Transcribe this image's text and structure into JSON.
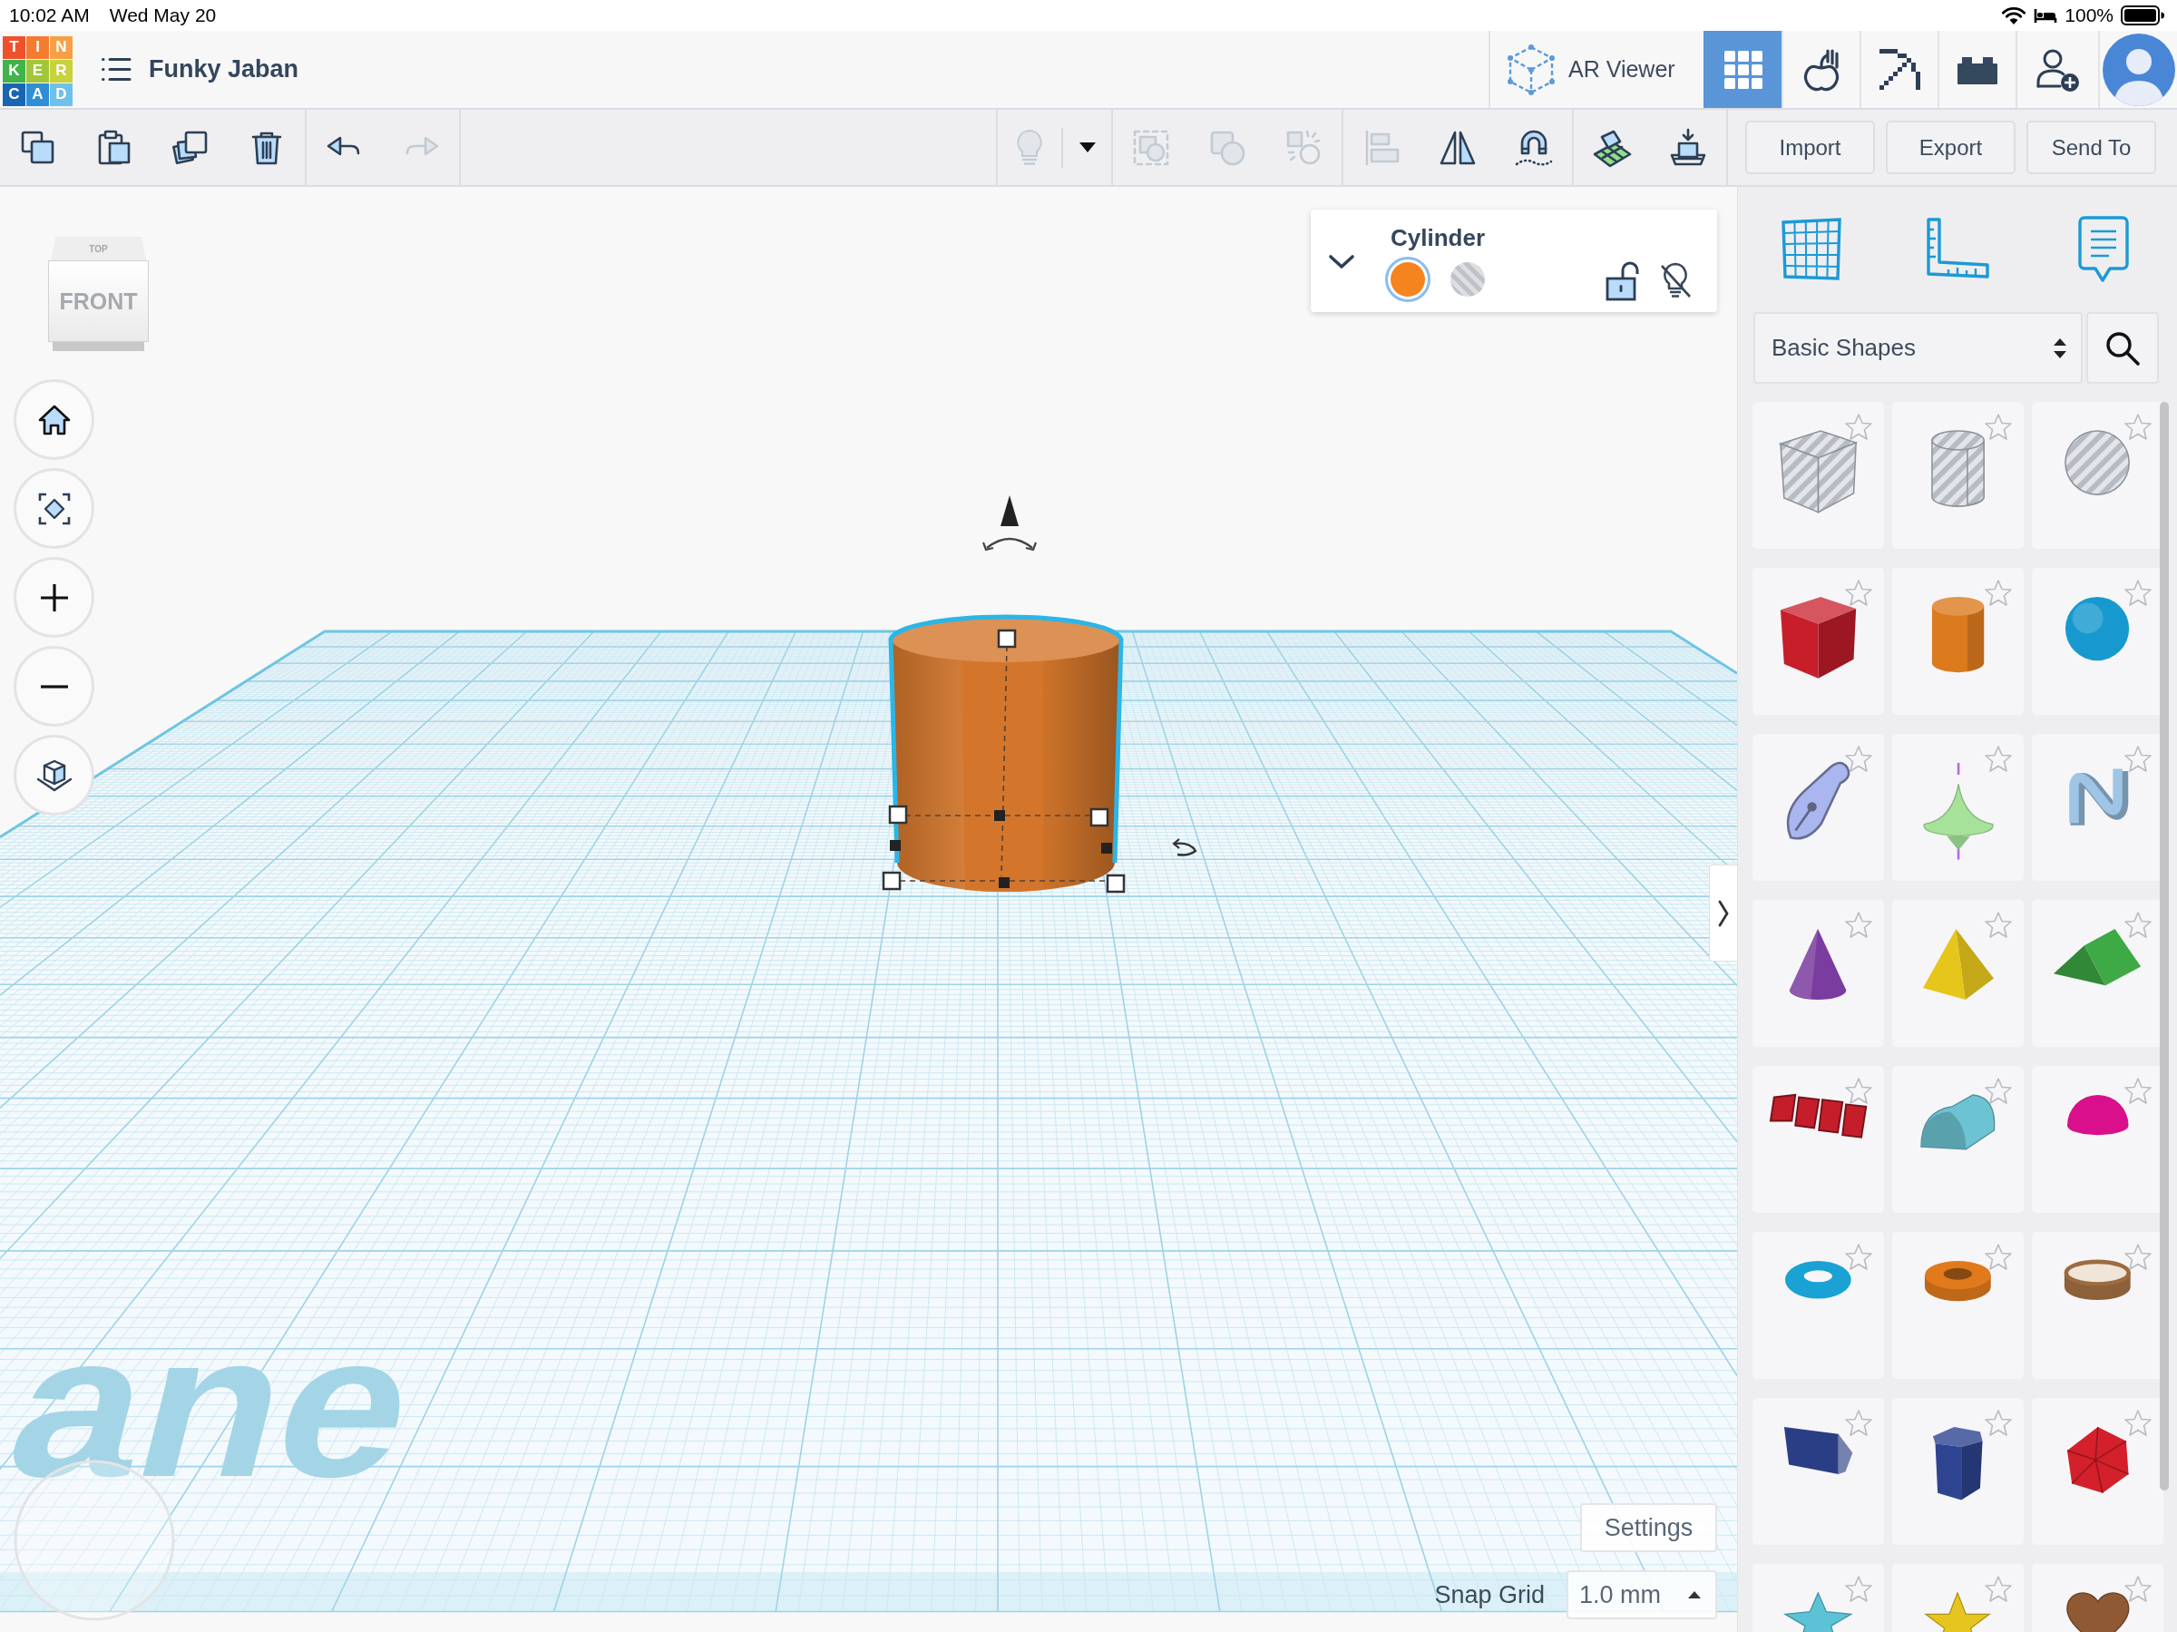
{
  "status_bar": {
    "time": "10:02 AM",
    "date": "Wed May 20",
    "battery": "100%"
  },
  "header": {
    "logo": [
      {
        "letter": "T",
        "color": "#ef512d"
      },
      {
        "letter": "I",
        "color": "#f47b30"
      },
      {
        "letter": "N",
        "color": "#f6a046"
      },
      {
        "letter": "K",
        "color": "#41b34a"
      },
      {
        "letter": "E",
        "color": "#a2c63a"
      },
      {
        "letter": "R",
        "color": "#c8d33b"
      },
      {
        "letter": "C",
        "color": "#1866b1"
      },
      {
        "letter": "A",
        "color": "#2f8fd6"
      },
      {
        "letter": "D",
        "color": "#6ec1e8"
      }
    ],
    "title": "Funky Jaban",
    "ar_viewer": "AR Viewer",
    "modes": [
      {
        "kind": "grid",
        "selected": true
      },
      {
        "kind": "apple",
        "selected": false
      },
      {
        "kind": "pickaxe",
        "selected": false
      },
      {
        "kind": "brick",
        "selected": false
      }
    ]
  },
  "toolbar": {
    "left_groups": [
      [
        {
          "kind": "copy",
          "disabled": false
        },
        {
          "kind": "paste",
          "disabled": false
        },
        {
          "kind": "duplicate",
          "disabled": false
        },
        {
          "kind": "delete",
          "disabled": false
        }
      ],
      [
        {
          "kind": "undo",
          "disabled": false
        },
        {
          "kind": "redo",
          "disabled": true
        }
      ]
    ],
    "right_groups": [
      [
        {
          "kind": "bulb",
          "disabled": true
        },
        {
          "kind": "caret",
          "disabled": false
        }
      ],
      [
        {
          "kind": "group",
          "disabled": true
        },
        {
          "kind": "combine",
          "disabled": true
        },
        {
          "kind": "ungroup",
          "disabled": true
        }
      ],
      [
        {
          "kind": "align",
          "disabled": true
        },
        {
          "kind": "mirror",
          "disabled": false
        },
        {
          "kind": "magnet",
          "disabled": false
        }
      ],
      [
        {
          "kind": "workplane",
          "disabled": false
        },
        {
          "kind": "drop",
          "disabled": false
        }
      ]
    ],
    "buttons": [
      "Import",
      "Export",
      "Send To"
    ]
  },
  "canvas": {
    "view_cube": {
      "top": "TOP",
      "front": "FRONT"
    },
    "nav_buttons": [
      {
        "kind": "home"
      },
      {
        "kind": "fit"
      },
      {
        "kind": "zoom-in"
      },
      {
        "kind": "zoom-out"
      },
      {
        "kind": "ortho"
      }
    ],
    "inspector": {
      "expanded": false,
      "title": "Cylinder",
      "options": [
        {
          "kind": "solid",
          "color": "#f5841f",
          "selected": true
        },
        {
          "kind": "hole",
          "selected": false
        }
      ],
      "locked": false
    },
    "object": {
      "kind": "cylinder",
      "color": "#d3762b",
      "selected": true
    },
    "workplane_label": "ane",
    "settings": "Settings",
    "snap_grid": {
      "label": "Snap Grid",
      "value": "1.0 mm"
    }
  },
  "library": {
    "tools": [
      {
        "kind": "workplane"
      },
      {
        "kind": "ruler"
      },
      {
        "kind": "notes"
      }
    ],
    "category": "Basic Shapes",
    "shapes": [
      {
        "kind": "box",
        "hole": true,
        "favorite": false
      },
      {
        "kind": "cylinder",
        "hole": true,
        "favorite": false
      },
      {
        "kind": "sphere",
        "hole": true,
        "favorite": false
      },
      {
        "kind": "box",
        "hole": false,
        "color": "#c81e2a",
        "favorite": false
      },
      {
        "kind": "cylinder",
        "hole": false,
        "color": "#dc7a1e",
        "favorite": false
      },
      {
        "kind": "sphere",
        "hole": false,
        "color": "#1799cf",
        "favorite": false
      },
      {
        "kind": "scribble",
        "hole": false,
        "color": "#aab6ef",
        "favorite": false
      },
      {
        "kind": "paraboloid",
        "hole": false,
        "color": "#a6e29a",
        "favorite": false
      },
      {
        "kind": "curve",
        "hole": false,
        "color": "#9ec5e6",
        "favorite": false
      },
      {
        "kind": "cone",
        "hole": false,
        "color": "#7a3c9e",
        "favorite": false
      },
      {
        "kind": "pyramid",
        "hole": false,
        "color": "#e6c61b",
        "favorite": false
      },
      {
        "kind": "roof",
        "hole": false,
        "color": "#3daa45",
        "favorite": false
      },
      {
        "kind": "text",
        "hole": false,
        "color": "#c41e2b",
        "favorite": false
      },
      {
        "kind": "round-roof",
        "hole": false,
        "color": "#6cc4d2",
        "favorite": false
      },
      {
        "kind": "half-sphere",
        "hole": false,
        "color": "#d90f8c",
        "favorite": false
      },
      {
        "kind": "torus",
        "hole": false,
        "color": "#1aa2d4",
        "favorite": false
      },
      {
        "kind": "tube",
        "hole": false,
        "color": "#e07a1c",
        "favorite": false
      },
      {
        "kind": "ring",
        "hole": false,
        "color": "#9c6b3f",
        "favorite": false
      },
      {
        "kind": "pentagonal-prism",
        "hole": false,
        "color": "#2a3e85",
        "favorite": false
      },
      {
        "kind": "hexagonal-prism",
        "hole": false,
        "color": "#2e4491",
        "favorite": false
      },
      {
        "kind": "icosahedron",
        "hole": false,
        "color": "#d3202b",
        "favorite": false
      },
      {
        "kind": "star-flat",
        "hole": false,
        "color": "#5cc2d6",
        "favorite": false
      },
      {
        "kind": "star",
        "hole": false,
        "color": "#e6c61e",
        "favorite": false
      },
      {
        "kind": "heart",
        "hole": false,
        "color": "#8f5a33",
        "favorite": false
      }
    ]
  }
}
